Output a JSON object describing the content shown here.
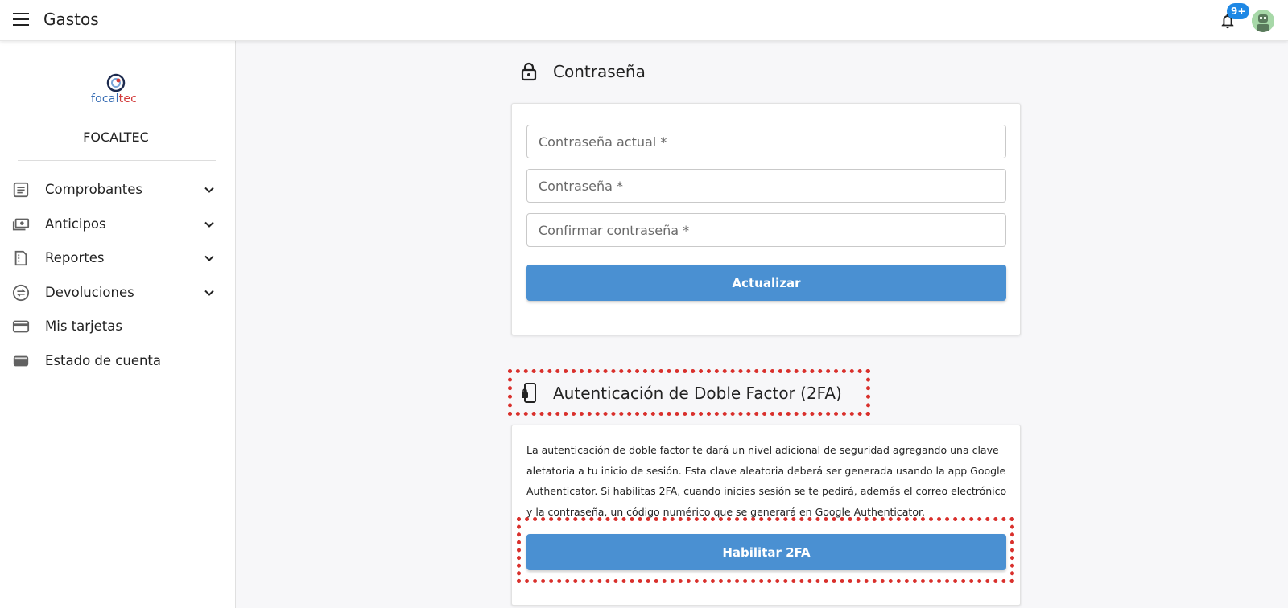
{
  "topbar": {
    "app_title": "Gastos",
    "notification_badge": "9+"
  },
  "sidebar": {
    "logo_text_part1": "focal",
    "logo_text_part2": "tec",
    "org_name": "FOCALTEC",
    "items": [
      {
        "label": "Comprobantes",
        "icon": "receipt-icon",
        "expandable": true
      },
      {
        "label": "Anticipos",
        "icon": "cash-icon",
        "expandable": true
      },
      {
        "label": "Reportes",
        "icon": "report-icon",
        "expandable": true
      },
      {
        "label": "Devoluciones",
        "icon": "swap-icon",
        "expandable": true
      },
      {
        "label": "Mis tarjetas",
        "icon": "credit-card-icon",
        "expandable": false
      },
      {
        "label": "Estado de cuenta",
        "icon": "wallet-icon",
        "expandable": false
      }
    ]
  },
  "password_section": {
    "title": "Contraseña",
    "current_placeholder": "Contraseña actual *",
    "new_placeholder": "Contraseña *",
    "confirm_placeholder": "Confirmar contraseña *",
    "submit_label": "Actualizar"
  },
  "twofa_section": {
    "title": "Autenticación de Doble Factor (2FA)",
    "description": "La autenticación de doble factor te dará un nivel adicional de seguridad agregando una clave aletatoria a tu inicio de sesión. Esta clave aleatoria deberá ser generada usando la app Google Authenticator. Si habilitas 2FA, cuando inicies sesión se te pedirá, además el correo electrónico y la contraseña, un código numérico que se generará en Google Authenticator.",
    "enable_label": "Habilitar 2FA"
  },
  "colors": {
    "primary_button": "#4a90d2",
    "badge": "#1e88e5",
    "highlight": "#d9302c"
  }
}
